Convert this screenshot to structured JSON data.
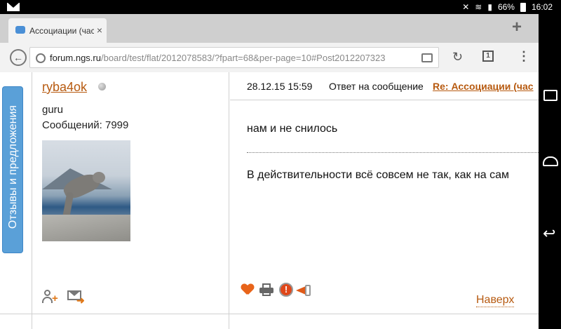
{
  "status_bar": {
    "battery": "66%",
    "time": "16:02"
  },
  "browser": {
    "tab": {
      "title": "Ассоциации (час",
      "close": "×"
    },
    "new_tab": "+",
    "url": {
      "domain": "forum.ngs.ru",
      "path": "/board/test/flat/2012078583/?fpart=68&per-page=10#Post2012207323"
    },
    "tabs_count": "1"
  },
  "page": {
    "feedback_tab": "Отзывы и предложения",
    "author": {
      "name": "ryba4ok",
      "rank": "guru",
      "messages": "Сообщений: 7999"
    },
    "post": {
      "date": "28.12.15 15:59",
      "reply_label": "Ответ на сообщение",
      "reply_link": "Re: Ассоциации (час",
      "quote": "нам и не снилось",
      "text": "В действительности всё совсем не так, как на сам",
      "to_top": "Наверх"
    }
  },
  "icons": {
    "avatar": "cat-photo",
    "actions": [
      "heart-icon",
      "print-icon",
      "warning-icon",
      "megaphone-icon"
    ]
  },
  "colors": {
    "link": "#b75a10",
    "feedback": "#5aa0d8"
  }
}
